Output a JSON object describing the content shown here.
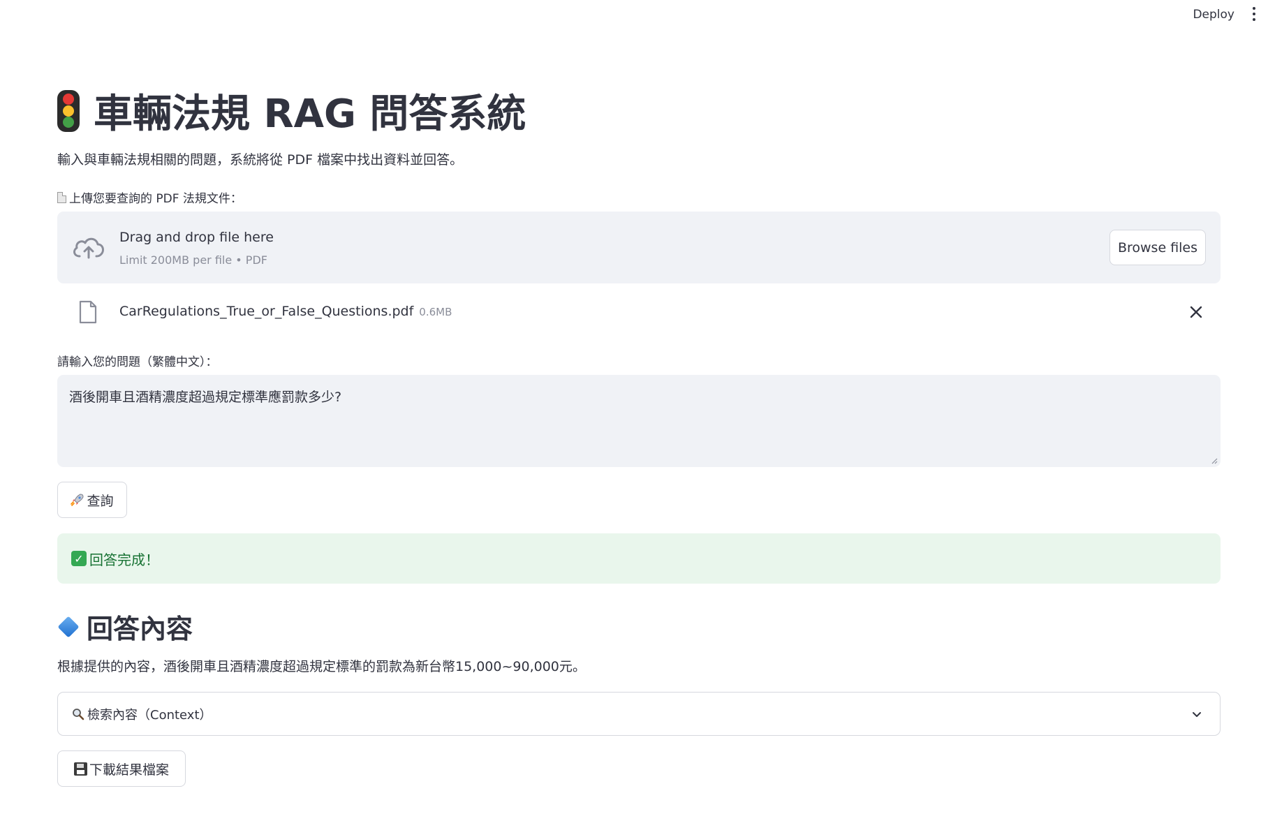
{
  "topbar": {
    "deploy_label": "Deploy",
    "menu_icon": "kebab-menu-icon"
  },
  "header": {
    "icon": "traffic-light-icon",
    "title": "車輛法規 RAG 問答系統",
    "subtitle": "輸入與車輛法規相關的問題，系統將從 PDF 檔案中找出資料並回答。"
  },
  "uploader": {
    "label_icon": "document-icon",
    "label": "上傳您要查詢的 PDF 法規文件：",
    "dropzone_icon": "cloud-upload-icon",
    "dropzone_title": "Drag and drop file here",
    "dropzone_hint": "Limit 200MB per file • PDF",
    "browse_label": "Browse files",
    "file": {
      "icon": "file-icon",
      "name": "CarRegulations_True_or_False_Questions.pdf",
      "size": "0.6MB",
      "remove_icon": "close-icon"
    }
  },
  "question": {
    "label": "請輸入您的問題（繁體中文）：",
    "value": "酒後開車且酒精濃度超過規定標準應罰款多少?"
  },
  "query_button": {
    "icon": "rocket-icon",
    "label": "查詢"
  },
  "status": {
    "icon": "check-mark-icon",
    "message": "回答完成！"
  },
  "answer": {
    "icon": "blue-diamond-icon",
    "title": "回答內容",
    "text": "根據提供的內容，酒後開車且酒精濃度超過規定標準的罰款為新台幣15,000~90,000元。"
  },
  "context_expander": {
    "icon": "magnifier-icon",
    "label": "檢索內容（Context）",
    "toggle_icon": "chevron-down-icon"
  },
  "download_button": {
    "icon": "floppy-disk-icon",
    "label": "下載結果檔案"
  },
  "colors": {
    "text": "#31333f",
    "panel_bg": "#f0f2f6",
    "success_bg": "#e9f6ec",
    "success_text": "#177233",
    "muted": "#8a8d99"
  }
}
